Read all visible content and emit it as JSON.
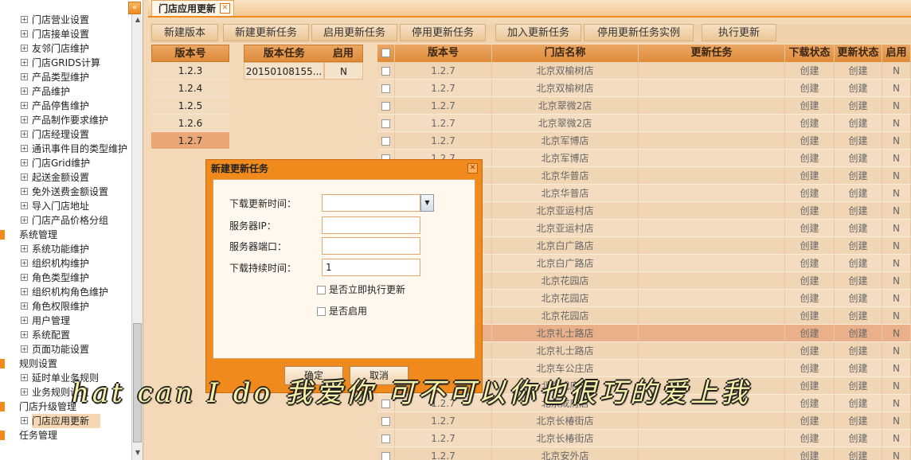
{
  "sidebar": {
    "items": [
      {
        "label": "门店营业设置",
        "type": "leaf"
      },
      {
        "label": "门店接单设置",
        "type": "leaf"
      },
      {
        "label": "友邻门店维护",
        "type": "leaf"
      },
      {
        "label": "门店GRIDS计算",
        "type": "leaf"
      },
      {
        "label": "产品类型维护",
        "type": "leaf"
      },
      {
        "label": "产品维护",
        "type": "leaf"
      },
      {
        "label": "产品停售维护",
        "type": "leaf"
      },
      {
        "label": "产品制作要求维护",
        "type": "leaf"
      },
      {
        "label": "门店经理设置",
        "type": "leaf"
      },
      {
        "label": "通讯事件目的类型维护",
        "type": "leaf"
      },
      {
        "label": "门店Grid维护",
        "type": "leaf"
      },
      {
        "label": "起送金额设置",
        "type": "leaf"
      },
      {
        "label": "免外送费金额设置",
        "type": "leaf"
      },
      {
        "label": "导入门店地址",
        "type": "leaf"
      },
      {
        "label": "门店产品价格分组",
        "type": "leaf"
      },
      {
        "label": "系统管理",
        "type": "group"
      },
      {
        "label": "系统功能维护",
        "type": "leaf"
      },
      {
        "label": "组织机构维护",
        "type": "leaf"
      },
      {
        "label": "角色类型维护",
        "type": "leaf"
      },
      {
        "label": "组织机构角色维护",
        "type": "leaf"
      },
      {
        "label": "角色权限维护",
        "type": "leaf"
      },
      {
        "label": "用户管理",
        "type": "leaf"
      },
      {
        "label": "系统配置",
        "type": "leaf"
      },
      {
        "label": "页面功能设置",
        "type": "leaf"
      },
      {
        "label": "规则设置",
        "type": "group"
      },
      {
        "label": "延时单业务规则",
        "type": "leaf"
      },
      {
        "label": "业务规则设置",
        "type": "leaf"
      },
      {
        "label": "门店升级管理",
        "type": "group"
      },
      {
        "label": "门店应用更新",
        "type": "leaf",
        "selected": true
      },
      {
        "label": "任务管理",
        "type": "group"
      }
    ],
    "collapse_glyph": "«"
  },
  "tab": {
    "label": "门店应用更新",
    "close_glyph": "✕"
  },
  "toolbar": {
    "new_version": "新建版本",
    "new_task": "新建更新任务",
    "enable_task": "启用更新任务",
    "disable_task": "停用更新任务",
    "add_task": "加入更新任务",
    "disable_instance": "停用更新任务实例",
    "execute": "执行更新"
  },
  "versions": {
    "header": "版本号",
    "rows": [
      "1.2.3",
      "1.2.4",
      "1.2.5",
      "1.2.6",
      "1.2.7"
    ],
    "selected_index": 4
  },
  "tasks": {
    "headers": {
      "task": "版本任务",
      "enabled": "启用"
    },
    "rows": [
      {
        "task": "20150108155...",
        "enabled": "N"
      }
    ]
  },
  "grid": {
    "headers": {
      "version": "版本号",
      "store": "门店名称",
      "task": "更新任务",
      "download_status": "下载状态",
      "update_status": "更新状态",
      "enabled": "启用"
    },
    "rows": [
      {
        "version": "1.2.7",
        "store": "北京双榆树店",
        "dl": "创建",
        "up": "创建",
        "en": "N"
      },
      {
        "version": "1.2.7",
        "store": "北京双榆树店",
        "dl": "创建",
        "up": "创建",
        "en": "N"
      },
      {
        "version": "1.2.7",
        "store": "北京翠微2店",
        "dl": "创建",
        "up": "创建",
        "en": "N"
      },
      {
        "version": "1.2.7",
        "store": "北京翠微2店",
        "dl": "创建",
        "up": "创建",
        "en": "N"
      },
      {
        "version": "1.2.7",
        "store": "北京军博店",
        "dl": "创建",
        "up": "创建",
        "en": "N"
      },
      {
        "version": "1.2.7",
        "store": "北京军博店",
        "dl": "创建",
        "up": "创建",
        "en": "N"
      },
      {
        "version": "1.2.7",
        "store": "北京华普店",
        "dl": "创建",
        "up": "创建",
        "en": "N"
      },
      {
        "version": "1.2.7",
        "store": "北京华普店",
        "dl": "创建",
        "up": "创建",
        "en": "N"
      },
      {
        "version": "1.2.7",
        "store": "北京亚运村店",
        "dl": "创建",
        "up": "创建",
        "en": "N"
      },
      {
        "version": "1.2.7",
        "store": "北京亚运村店",
        "dl": "创建",
        "up": "创建",
        "en": "N"
      },
      {
        "version": "1.2.7",
        "store": "北京白广路店",
        "dl": "创建",
        "up": "创建",
        "en": "N"
      },
      {
        "version": "1.2.7",
        "store": "北京白广路店",
        "dl": "创建",
        "up": "创建",
        "en": "N"
      },
      {
        "version": "1.2.7",
        "store": "北京花园店",
        "dl": "创建",
        "up": "创建",
        "en": "N"
      },
      {
        "version": "1.2.7",
        "store": "北京花园店",
        "dl": "创建",
        "up": "创建",
        "en": "N"
      },
      {
        "version": "1.2.7",
        "store": "北京花园店",
        "dl": "创建",
        "up": "创建",
        "en": "N"
      },
      {
        "version": "1.2.7",
        "store": "北京礼士路店",
        "dl": "创建",
        "up": "创建",
        "en": "N",
        "highlight": true
      },
      {
        "version": "1.2.7",
        "store": "北京礼士路店",
        "dl": "创建",
        "up": "创建",
        "en": "N"
      },
      {
        "version": "1.2.7",
        "store": "北京车公庄店",
        "dl": "创建",
        "up": "创建",
        "en": "N"
      },
      {
        "version": "1.2.7",
        "store": "北京成府店",
        "dl": "创建",
        "up": "创建",
        "en": "N"
      },
      {
        "version": "1.2.7",
        "store": "北京成府店",
        "dl": "创建",
        "up": "创建",
        "en": "N"
      },
      {
        "version": "1.2.7",
        "store": "北京长椿街店",
        "dl": "创建",
        "up": "创建",
        "en": "N"
      },
      {
        "version": "1.2.7",
        "store": "北京长椿街店",
        "dl": "创建",
        "up": "创建",
        "en": "N"
      },
      {
        "version": "1.2.7",
        "store": "北京安外店",
        "dl": "创建",
        "up": "创建",
        "en": "N"
      }
    ]
  },
  "dialog": {
    "title": "新建更新任务",
    "fields": {
      "download_time": {
        "label": "下载更新时间：",
        "value": ""
      },
      "server_ip": {
        "label": "服务器IP：",
        "value": ""
      },
      "server_port": {
        "label": "服务器端口：",
        "value": ""
      },
      "download_duration": {
        "label": "下载持续时间：",
        "value": "1"
      }
    },
    "execute_now": "是否立即执行更新",
    "enable": "是否启用",
    "ok": "确定",
    "cancel": "取消"
  },
  "subtitle": "hat can I do 我爱你 可不可以你也很巧的爱上我",
  "colors": {
    "accent": "#f08a1c",
    "header": "#e39545",
    "selected_row": "#eaa675"
  }
}
